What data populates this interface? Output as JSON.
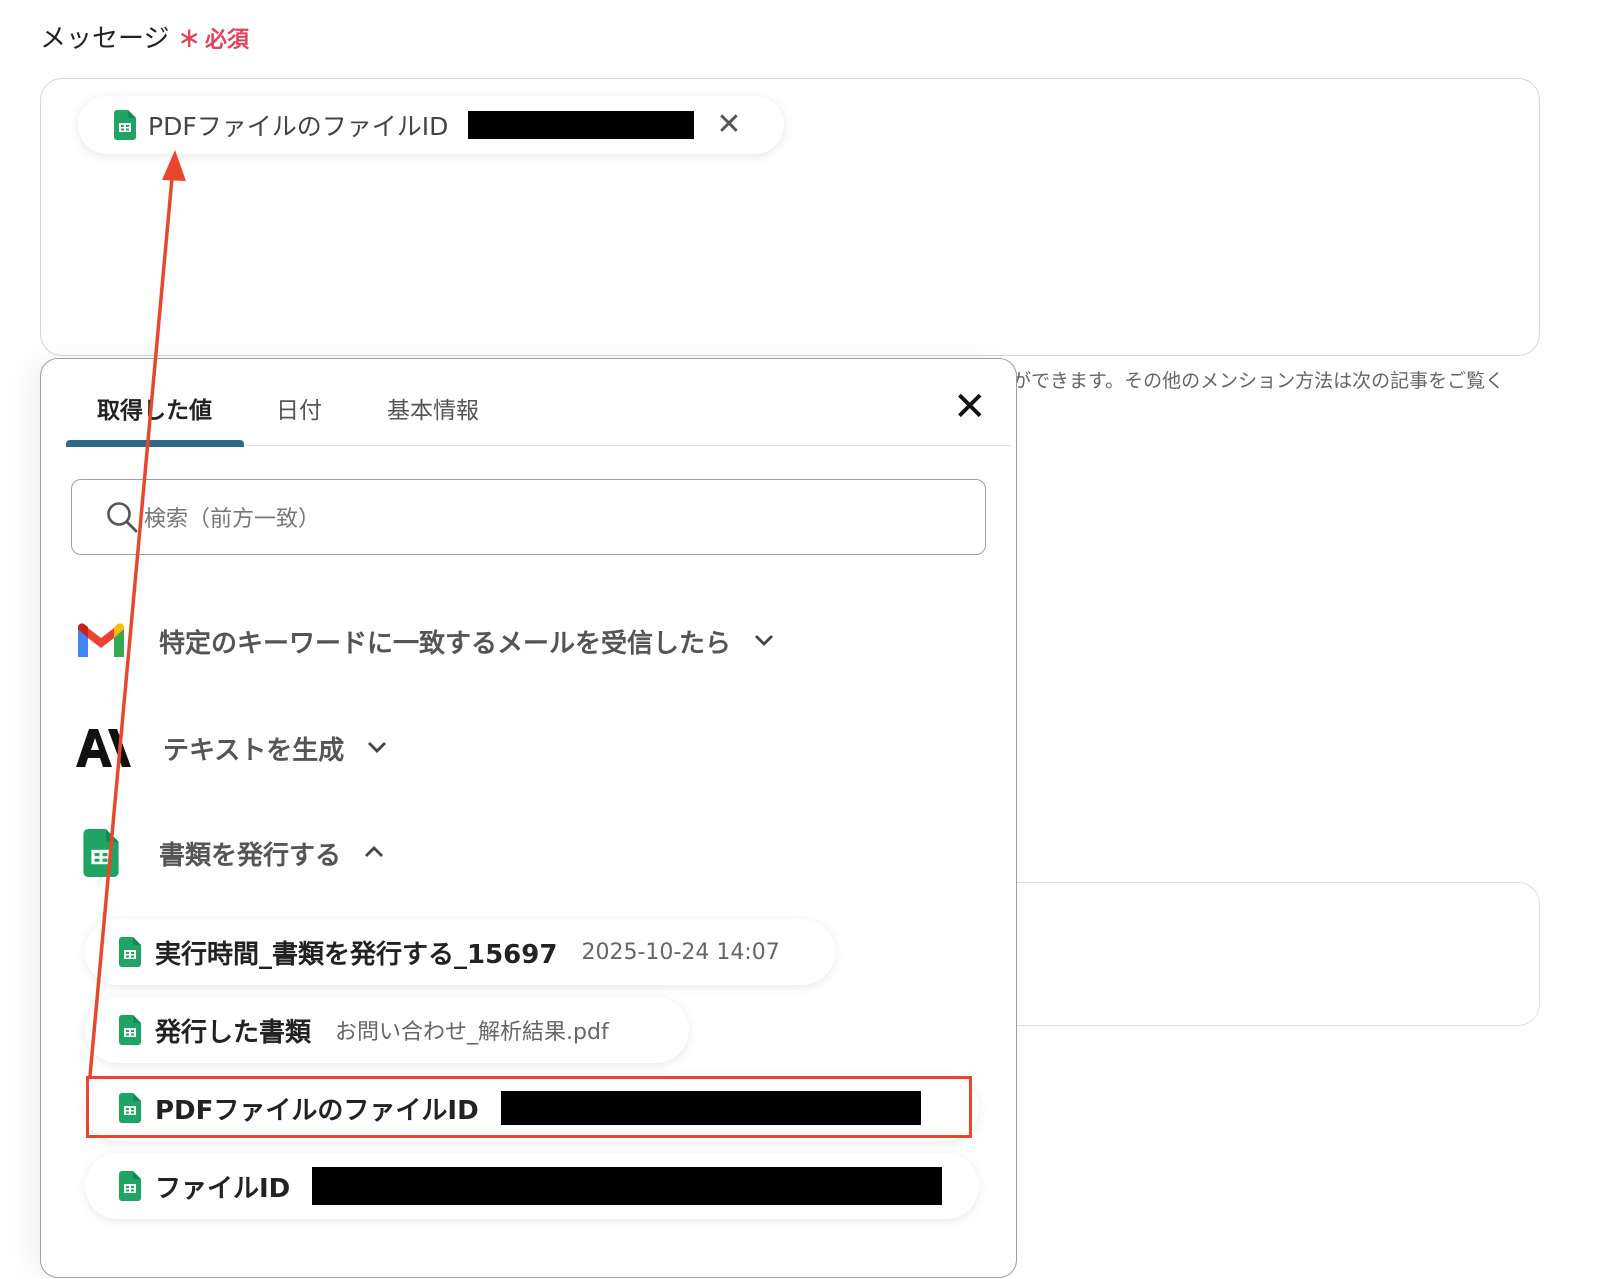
{
  "field": {
    "label": "メッセージ",
    "required_mark": "∗",
    "required_text": "必須"
  },
  "message_chip": {
    "label": "PDFファイルのファイルID",
    "close_glyph": "✕"
  },
  "hint_text": "ができます。その他のメンション方法は次の記事をご覧く",
  "popup": {
    "tabs": [
      {
        "label": "取得した値"
      },
      {
        "label": "日付"
      },
      {
        "label": "基本情報"
      }
    ],
    "close_glyph": "✕",
    "search": {
      "placeholder": "検索（前方一致）"
    },
    "groups": [
      {
        "title": "特定のキーワードに一致するメールを受信したら",
        "icon": "gmail-icon"
      },
      {
        "title": "テキストを生成",
        "icon": "anthropic-icon"
      },
      {
        "title": "書類を発行する",
        "icon": "google-sheets-icon"
      }
    ],
    "items": [
      {
        "name": "実行時間_書類を発行する_15697",
        "value": "2025-10-24 14:07"
      },
      {
        "name": "発行した書類",
        "value": "お問い合わせ_解析結果.pdf"
      },
      {
        "name": "PDFファイルのファイルID"
      },
      {
        "name": "ファイルID"
      }
    ]
  },
  "colors": {
    "accent_underline": "#2e6b8a",
    "annotation_red": "#e8472e",
    "required_red": "#e0435a",
    "sheets_green": "#1fa463"
  }
}
